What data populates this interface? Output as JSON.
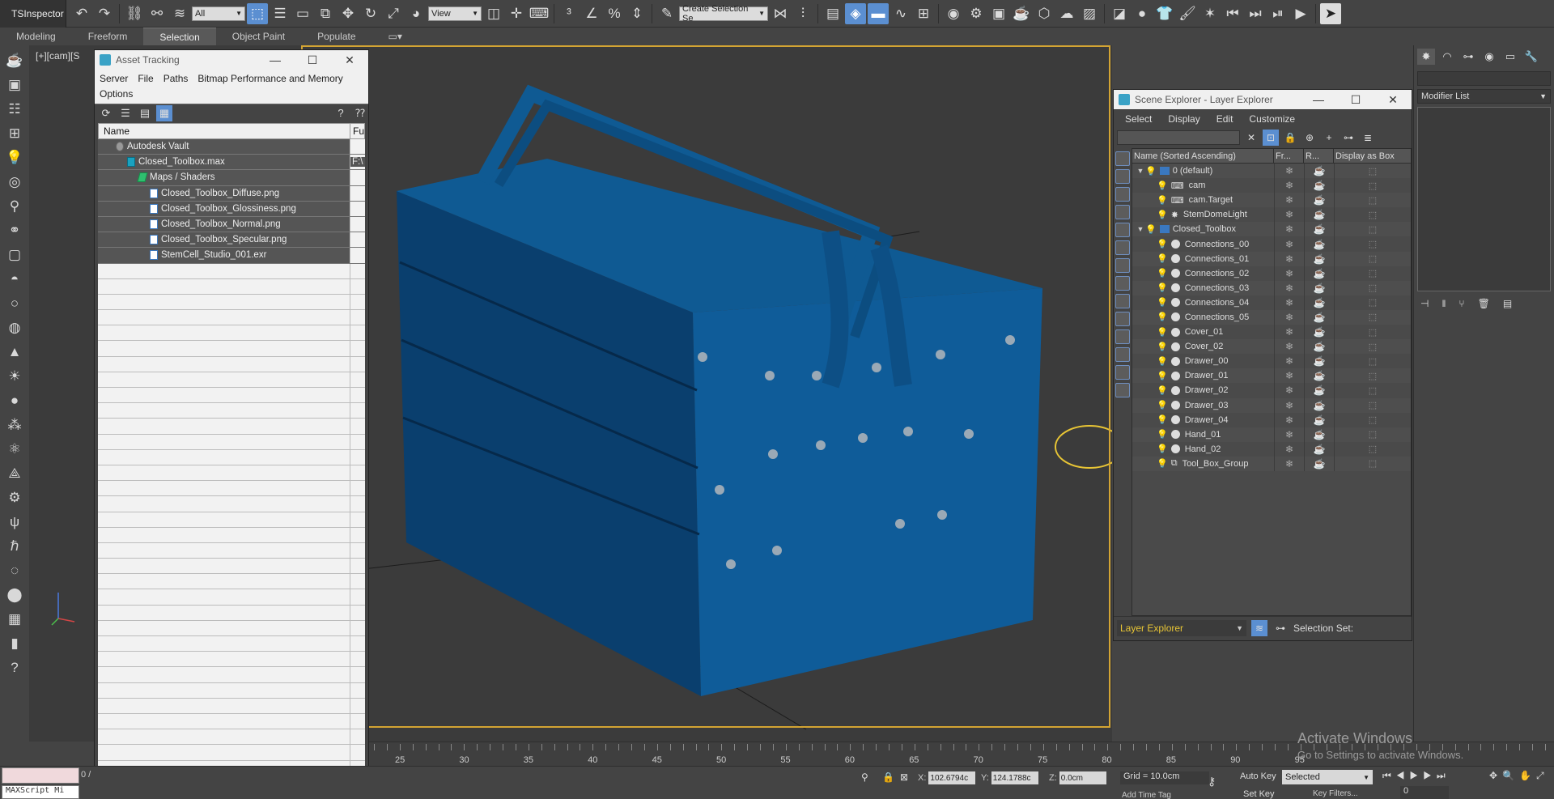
{
  "app": {
    "inspector_label": "TSInspector"
  },
  "toolbar": {
    "selection_filter": "All",
    "reference_coord": "View",
    "selection_set_placeholder": "Create Selection Se"
  },
  "ribbon": {
    "tabs": [
      "Modeling",
      "Freeform",
      "Selection",
      "Object Paint",
      "Populate"
    ],
    "active": "Selection"
  },
  "viewport": {
    "label": "[+][cam][S"
  },
  "asset_tracking": {
    "title": "Asset Tracking",
    "menu": [
      "Server",
      "File",
      "Paths",
      "Bitmap Performance and Memory",
      "Options"
    ],
    "columns": {
      "name": "Name",
      "full_path": "Fu"
    },
    "rows": [
      {
        "name": "Autodesk Vault",
        "path": "",
        "indent": 0,
        "icon": "vault"
      },
      {
        "name": "Closed_Toolbox.max",
        "path": "F:\\",
        "indent": 1,
        "icon": "max"
      },
      {
        "name": "Maps / Shaders",
        "path": "",
        "indent": 2,
        "icon": "folder"
      },
      {
        "name": "Closed_Toolbox_Diffuse.png",
        "path": "",
        "indent": 3,
        "icon": "file"
      },
      {
        "name": "Closed_Toolbox_Glossiness.png",
        "path": "",
        "indent": 3,
        "icon": "file"
      },
      {
        "name": "Closed_Toolbox_Normal.png",
        "path": "",
        "indent": 3,
        "icon": "file"
      },
      {
        "name": "Closed_Toolbox_Specular.png",
        "path": "",
        "indent": 3,
        "icon": "file"
      },
      {
        "name": "StemCell_Studio_001.exr",
        "path": "",
        "indent": 3,
        "icon": "file"
      }
    ]
  },
  "scene_explorer": {
    "title": "Scene Explorer - Layer Explorer",
    "menu": [
      "Select",
      "Display",
      "Edit",
      "Customize"
    ],
    "columns": {
      "name": "Name (Sorted Ascending)",
      "frozen": "Fr...",
      "renderable": "R...",
      "display_as_box": "Display as Box"
    },
    "rows": [
      {
        "name": "0 (default)",
        "type": "layer",
        "indent": 0,
        "expand": "▼"
      },
      {
        "name": "cam",
        "type": "camera",
        "indent": 1,
        "expand": ""
      },
      {
        "name": "cam.Target",
        "type": "camera",
        "indent": 1,
        "expand": ""
      },
      {
        "name": "StemDomeLight",
        "type": "light",
        "indent": 1,
        "expand": ""
      },
      {
        "name": "Closed_Toolbox",
        "type": "layer",
        "indent": 0,
        "expand": "▼"
      },
      {
        "name": "Connections_00",
        "type": "object",
        "indent": 1,
        "expand": ""
      },
      {
        "name": "Connections_01",
        "type": "object",
        "indent": 1,
        "expand": ""
      },
      {
        "name": "Connections_02",
        "type": "object",
        "indent": 1,
        "expand": ""
      },
      {
        "name": "Connections_03",
        "type": "object",
        "indent": 1,
        "expand": ""
      },
      {
        "name": "Connections_04",
        "type": "object",
        "indent": 1,
        "expand": ""
      },
      {
        "name": "Connections_05",
        "type": "object",
        "indent": 1,
        "expand": ""
      },
      {
        "name": "Cover_01",
        "type": "object",
        "indent": 1,
        "expand": ""
      },
      {
        "name": "Cover_02",
        "type": "object",
        "indent": 1,
        "expand": ""
      },
      {
        "name": "Drawer_00",
        "type": "object",
        "indent": 1,
        "expand": ""
      },
      {
        "name": "Drawer_01",
        "type": "object",
        "indent": 1,
        "expand": ""
      },
      {
        "name": "Drawer_02",
        "type": "object",
        "indent": 1,
        "expand": ""
      },
      {
        "name": "Drawer_03",
        "type": "object",
        "indent": 1,
        "expand": ""
      },
      {
        "name": "Drawer_04",
        "type": "object",
        "indent": 1,
        "expand": ""
      },
      {
        "name": "Hand_01",
        "type": "object",
        "indent": 1,
        "expand": ""
      },
      {
        "name": "Hand_02",
        "type": "object",
        "indent": 1,
        "expand": ""
      },
      {
        "name": "Tool_Box_Group",
        "type": "group",
        "indent": 1,
        "expand": ""
      }
    ],
    "footer": {
      "explorer": "Layer Explorer",
      "selection_set_label": "Selection Set:"
    }
  },
  "command_panel": {
    "modifier_list": "Modifier List"
  },
  "timeline": {
    "ticks": [
      25,
      30,
      35,
      40,
      45,
      50,
      55,
      60,
      65,
      70,
      75,
      80,
      85,
      90,
      95
    ]
  },
  "status": {
    "frame_display": "0 /",
    "x_label": "X:",
    "x_value": "102.6794c",
    "y_label": "Y:",
    "y_value": "124.1788c",
    "z_label": "Z:",
    "z_value": "0.0cm",
    "grid": "Grid = 10.0cm",
    "add_time_tag": "Add Time Tag",
    "auto_key": "Auto Key",
    "set_key": "Set Key",
    "selected": "Selected",
    "key_filters": "Key Filters...",
    "current_frame": "0",
    "maxscript": "MAXScript Mi"
  },
  "watermark": {
    "title": "Activate Windows",
    "subtitle": "Go to Settings to activate Windows."
  },
  "colors": {
    "toolbox_blue": "#0f5a93",
    "accent": "#5b8fd1",
    "viewport_border": "#d3a433"
  }
}
